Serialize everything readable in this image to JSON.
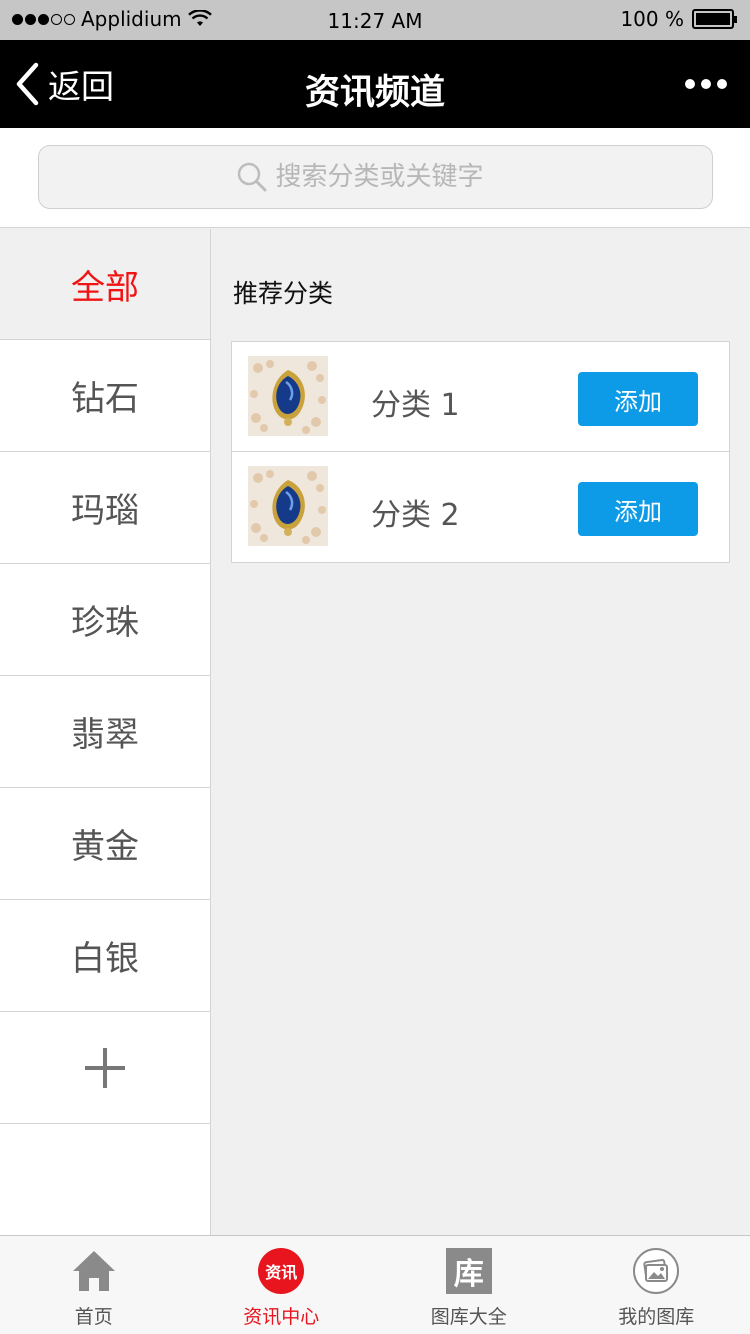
{
  "status_bar": {
    "carrier": "Applidium",
    "time": "11:27 AM",
    "battery_text": "100 %",
    "battery_level": 1.0
  },
  "nav": {
    "back_label": "返回",
    "title": "资讯频道"
  },
  "search": {
    "placeholder": "搜索分类或关键字"
  },
  "sidebar": {
    "all_label": "全部",
    "items": [
      {
        "label": "钻石"
      },
      {
        "label": "玛瑙"
      },
      {
        "label": "珍珠"
      },
      {
        "label": "翡翠"
      },
      {
        "label": "黄金"
      },
      {
        "label": "白银"
      }
    ]
  },
  "main": {
    "section_title": "推荐分类",
    "categories": [
      {
        "name": "分类 1",
        "button_label": "添加"
      },
      {
        "name": "分类 2",
        "button_label": "添加"
      }
    ]
  },
  "tab_bar": {
    "tabs": [
      {
        "label": "首页",
        "icon": "home-icon"
      },
      {
        "label": "资讯中心",
        "icon": "news-icon",
        "badge_text": "资讯"
      },
      {
        "label": "图库大全",
        "icon": "library-icon",
        "badge_text": "库"
      },
      {
        "label": "我的图库",
        "icon": "my-gallery-icon"
      }
    ],
    "active_index": 1
  },
  "colors": {
    "accent_red": "#e8141e",
    "button_blue": "#0d9be7",
    "nav_bg": "#000000"
  }
}
